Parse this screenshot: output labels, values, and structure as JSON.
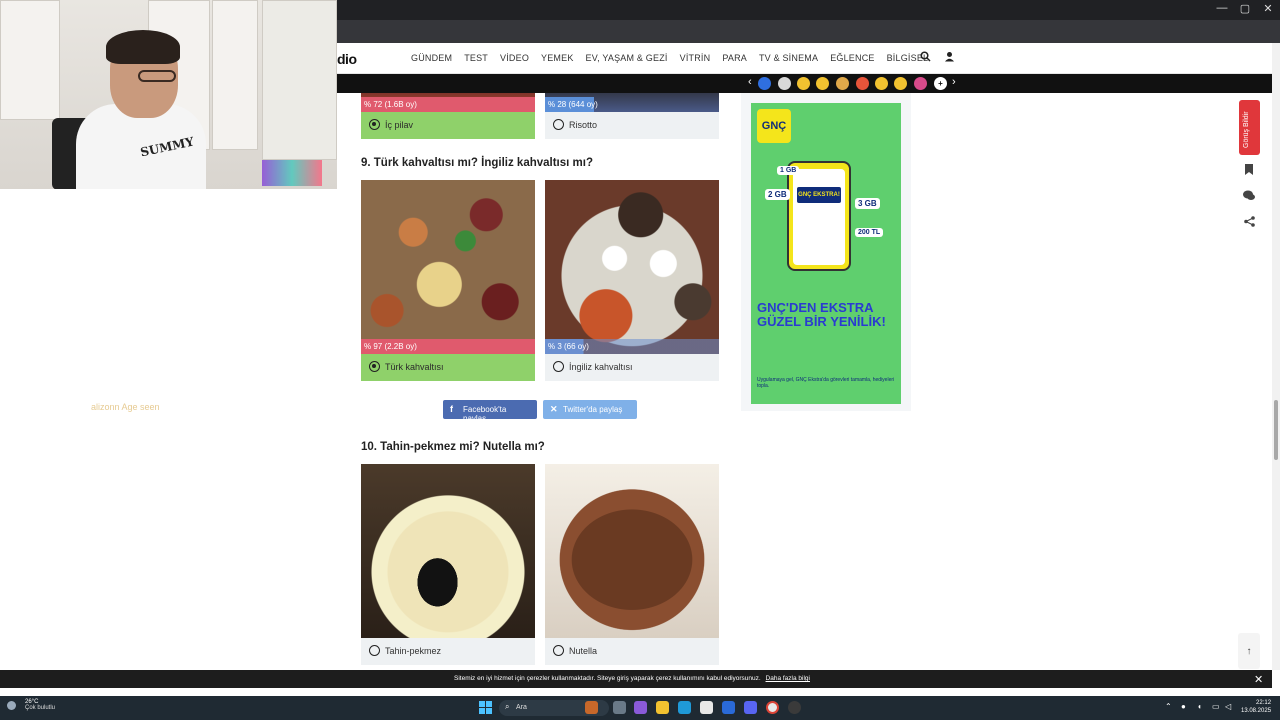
{
  "browser": {
    "window_controls": [
      "—",
      "▢",
      "✕"
    ]
  },
  "webcam": {
    "shirt_text": "SUMMY"
  },
  "overlay_text": "alizonn  Age seen",
  "site": {
    "logo": "dio",
    "nav": [
      "GÜNDEM",
      "TEST",
      "VİDEO",
      "YEMEK",
      "EV, YAŞAM & GEZİ",
      "VİTRİN",
      "PARA",
      "TV & SİNEMA",
      "EĞLENCE",
      "BİLGİSEL"
    ],
    "search_icon": "search-icon",
    "user_icon": "user-icon"
  },
  "emoji_strip": {
    "prev": "‹",
    "next": "›",
    "emojis": [
      "🆕",
      "🏁",
      "🚀",
      "😂",
      "🙂",
      "😍",
      "😢",
      "😎",
      "🤯",
      "➕"
    ]
  },
  "quiz": {
    "q8": {
      "options": [
        {
          "label": "İç pilav",
          "pct": "% 72 (1.6B oy)",
          "selected": true
        },
        {
          "label": "Risotto",
          "pct": "% 28 (644 oy)",
          "selected": false
        }
      ]
    },
    "q9": {
      "title": "9. Türk kahvaltısı mı? İngiliz kahvaltısı mı?",
      "options": [
        {
          "label": "Türk kahvaltısı",
          "pct": "% 97 (2.2B oy)",
          "selected": true
        },
        {
          "label": "İngiliz kahvaltısı",
          "pct": "% 3 (66 oy)",
          "selected": false
        }
      ]
    },
    "share": {
      "facebook": "Facebook'ta paylaş",
      "twitter": "Twitter'da paylaş"
    },
    "q10": {
      "title": "10. Tahin-pekmez mi? Nutella mı?",
      "options": [
        {
          "label": "Tahin-pekmez",
          "selected": false
        },
        {
          "label": "Nutella",
          "selected": false
        }
      ]
    }
  },
  "ad": {
    "brand": "GNÇ",
    "phone_banner": "GNÇ EKSTRA!",
    "gb_labels": [
      "1 GB",
      "2 GB",
      "3 GB",
      "200 TL"
    ],
    "headline": "GNÇ'DEN EKSTRA GÜZEL BİR YENİLİK!",
    "small_text": "Uygulamaya gel, GNÇ Ekstra'da görevleri tamamla, hediyeleri topla."
  },
  "side": {
    "feedback": "Görüş Bildir"
  },
  "cookie": {
    "text": "Sitemiz en iyi hizmet için çerezler kullanmaktadır. Siteye giriş yaparak çerez kullanımını kabul ediyorsunuz.",
    "link": "Daha fazla bilgi",
    "close": "✕"
  },
  "taskbar": {
    "temp": "26°C",
    "weather": "Çok bulutlu",
    "search_placeholder": "Ara",
    "time": "22:12",
    "date": "13.08.2025"
  },
  "colors": {
    "selected_green": "#8fd16a",
    "q8_left_bar": "#e05a6d",
    "q8_right_bar": "#5b8fd8",
    "q9_left_bar": "#e05a6d",
    "q9_right_bar": "#6b8fd0",
    "facebook": "#4b6bb1",
    "twitter": "#7fb0e8"
  }
}
